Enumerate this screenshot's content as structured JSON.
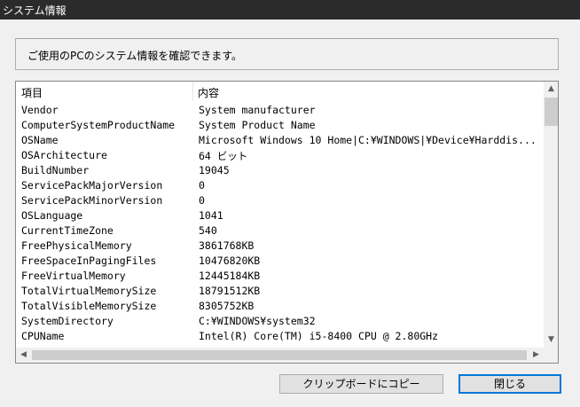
{
  "window": {
    "title": "システム情報"
  },
  "intro": {
    "text": "ご使用のPCのシステム情報を確認できます。"
  },
  "list": {
    "columns": {
      "key": "項目",
      "value": "内容"
    },
    "rows": [
      {
        "key": "Vendor",
        "value": "System manufacturer"
      },
      {
        "key": "ComputerSystemProductName",
        "value": "System Product Name"
      },
      {
        "key": "OSName",
        "value": "Microsoft Windows 10 Home|C:¥WINDOWS|¥Device¥Harddis..."
      },
      {
        "key": "OSArchitecture",
        "value": "64 ビット"
      },
      {
        "key": "BuildNumber",
        "value": "19045"
      },
      {
        "key": "ServicePackMajorVersion",
        "value": "0"
      },
      {
        "key": "ServicePackMinorVersion",
        "value": "0"
      },
      {
        "key": "OSLanguage",
        "value": "1041"
      },
      {
        "key": "CurrentTimeZone",
        "value": "540"
      },
      {
        "key": "FreePhysicalMemory",
        "value": "3861768KB"
      },
      {
        "key": "FreeSpaceInPagingFiles",
        "value": "10476820KB"
      },
      {
        "key": "FreeVirtualMemory",
        "value": "12445184KB"
      },
      {
        "key": "TotalVirtualMemorySize",
        "value": "18791512KB"
      },
      {
        "key": "TotalVisibleMemorySize",
        "value": "8305752KB"
      },
      {
        "key": "SystemDirectory",
        "value": "C:¥WINDOWS¥system32"
      },
      {
        "key": "CPUName",
        "value": "Intel(R) Core(TM) i5-8400 CPU @ 2.80GHz"
      }
    ]
  },
  "scrollbars": {
    "up_icon": "scroll-up-arrow-icon",
    "down_icon": "scroll-down-arrow-icon",
    "left_icon": "scroll-left-arrow-icon",
    "right_icon": "scroll-right-arrow-icon"
  },
  "buttons": {
    "copy": "クリップボードにコピー",
    "close": "閉じる"
  }
}
